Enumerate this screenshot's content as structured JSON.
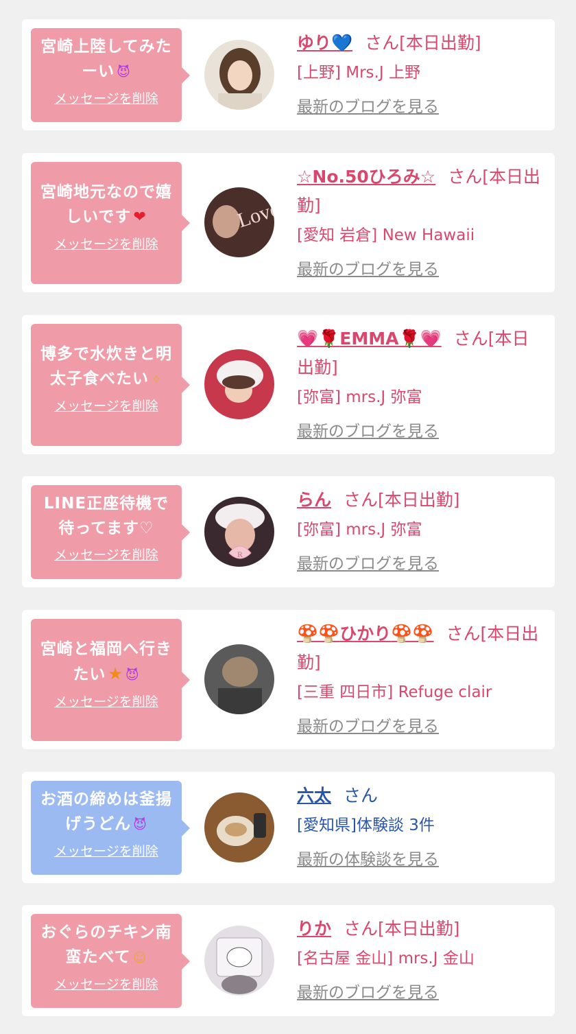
{
  "colors": {
    "page_bg": "#f0f0f0",
    "card_bg": "#ffffff",
    "bubble_pink": "#ef9ba8",
    "bubble_blue": "#9cbaf2",
    "girl_text": "#d9486c",
    "user_text": "#2a56a8",
    "link_gray": "#8a8a8a"
  },
  "delete_label": "メッセージを削除",
  "entries": [
    {
      "message": "宮崎上陸してみたーい",
      "emoji": "devil-smile-icon",
      "name_prefix": "",
      "name": "ゆり",
      "name_suffix": "💙",
      "honorific": "さん[本日出勤]",
      "shop": "[上野] Mrs.J 上野",
      "link": "最新のブログを見る"
    },
    {
      "message": "宮崎地元なので嬉しいです",
      "emoji": "red-heart-icon",
      "name_prefix": "",
      "name": "☆No.50ひろみ☆",
      "name_suffix": "",
      "honorific": "さん[本日出勤]",
      "shop": "[愛知 岩倉] New Hawaii",
      "link": "最新のブログを見る"
    },
    {
      "message": "博多で水炊きと明太子食べたい",
      "emoji": "sparkle-icon",
      "name_prefix": "💗🌹",
      "name": "EMMA",
      "name_suffix": "🌹💗",
      "honorific": "さん[本日出勤]",
      "shop": "[弥富] mrs.J 弥富",
      "link": "最新のブログを見る"
    },
    {
      "message": "LINE正座待機で待ってます♡",
      "emoji": "",
      "name_prefix": "",
      "name": "らん",
      "name_suffix": "",
      "honorific": "さん[本日出勤]",
      "shop": "[弥富] mrs.J 弥富",
      "link": "最新のブログを見る"
    },
    {
      "message": "宮崎と福岡へ行きたい",
      "emoji": "star-and-devil-icon",
      "name_prefix": "🍄🍄",
      "name": "ひかり",
      "name_suffix": "🍄🍄",
      "honorific": "さん[本日出勤]",
      "shop": "[三重 四日市] Refuge clair",
      "link": "最新のブログを見る"
    },
    {
      "message": "お酒の締めは釜揚げうどん",
      "emoji": "devil-smile-icon",
      "name_prefix": "",
      "name": "六太",
      "name_suffix": "",
      "honorific": "さん",
      "shop": "[愛知県]体験談 3件",
      "link": "最新の体験談を見る"
    },
    {
      "message": "おぐらのチキン南蛮たべて",
      "emoji": "grin-icon",
      "name_prefix": "",
      "name": "りか",
      "name_suffix": "",
      "honorific": "さん[本日出勤]",
      "shop": "[名古屋 金山] mrs.J 金山",
      "link": "最新のブログを見る"
    }
  ]
}
